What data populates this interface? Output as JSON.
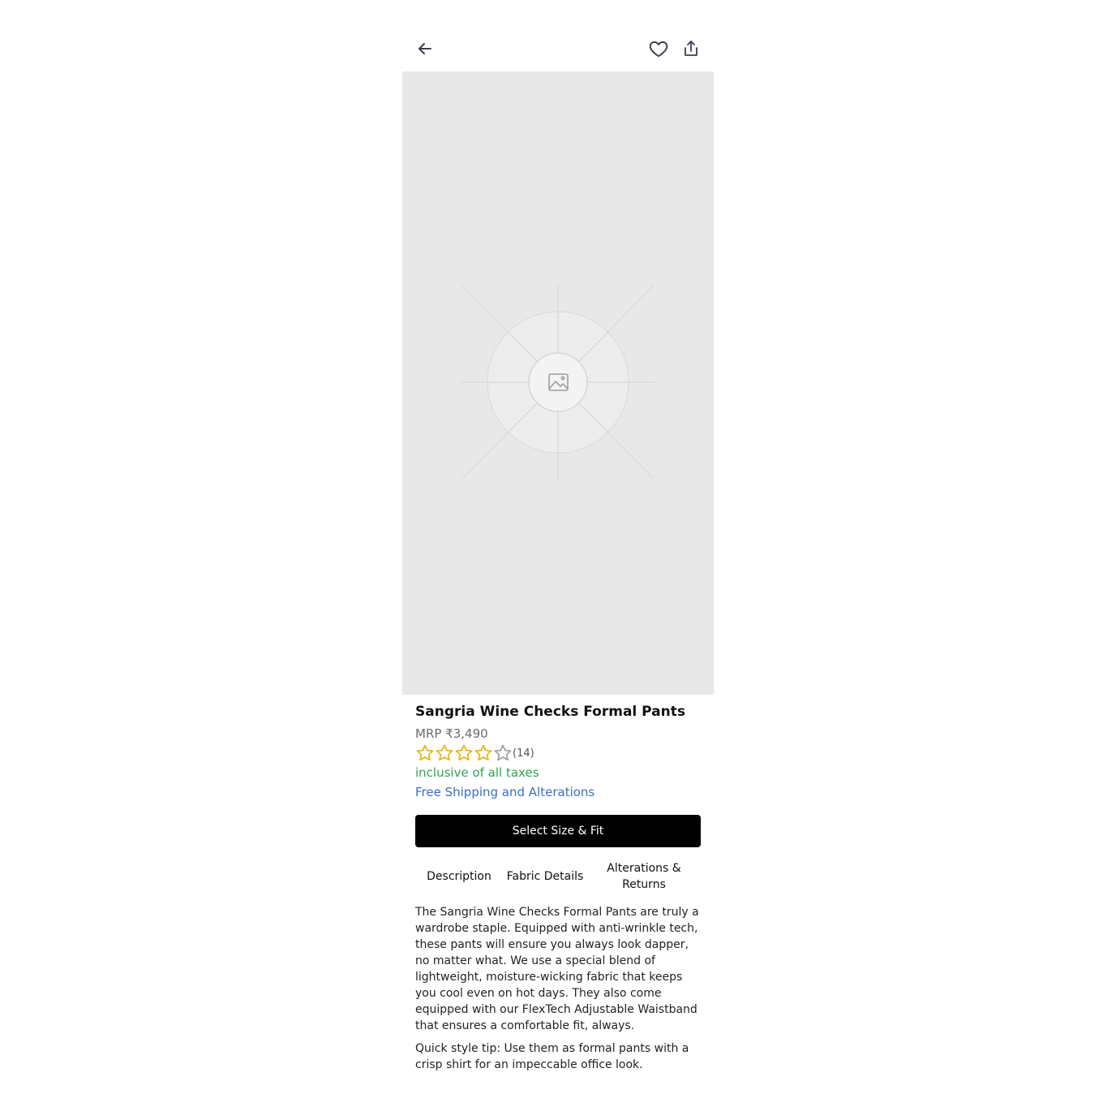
{
  "header": {
    "back_icon": "arrow-left-icon",
    "favorite_icon": "heart-icon",
    "share_icon": "share-icon"
  },
  "image": {
    "placeholder_icon": "image-icon",
    "background": "#e8e8e8"
  },
  "product": {
    "title": "Sangria Wine Checks Formal Pants",
    "price": "MRP ₹3,490",
    "rating": {
      "value": 4,
      "max": 5,
      "count_label": "(14)"
    },
    "tax_note": "inclusive of all taxes",
    "shipping_link": "Free Shipping and Alterations"
  },
  "cta": {
    "label": "Select Size & Fit"
  },
  "tabs": [
    {
      "label": "Description"
    },
    {
      "label": "Fabric Details"
    },
    {
      "label": "Alterations & Returns"
    }
  ],
  "description": {
    "paragraph_1": "The Sangria Wine Checks Formal Pants are truly a wardrobe staple. Equipped with anti-wrinkle tech, these pants will ensure you always look dapper, no matter what. We use a special blend of lightweight, moisture-wicking fabric that keeps you cool even on hot days. They also come equipped with our FlexTech Adjustable Waistband that ensures a comfortable fit, always.",
    "paragraph_2": "Quick style tip: Use them as formal pants with a crisp shirt for an impeccable office look."
  },
  "colors": {
    "star_filled": "#e5b100",
    "star_empty": "#9a9a9a",
    "tax_green": "#2ea44f",
    "link_blue": "#3a6fc4",
    "cta_bg": "#000000"
  }
}
